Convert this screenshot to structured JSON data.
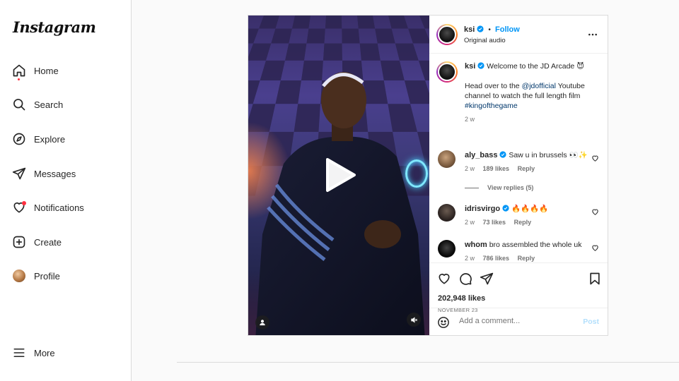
{
  "app": {
    "logo": "Instagram"
  },
  "sidebar": {
    "items": [
      {
        "label": "Home",
        "icon": "home-icon"
      },
      {
        "label": "Search",
        "icon": "search-icon"
      },
      {
        "label": "Explore",
        "icon": "compass-icon"
      },
      {
        "label": "Messages",
        "icon": "paper-plane-icon"
      },
      {
        "label": "Notifications",
        "icon": "heart-icon"
      },
      {
        "label": "Create",
        "icon": "plus-square-icon"
      },
      {
        "label": "Profile",
        "icon": "avatar"
      }
    ],
    "more_label": "More"
  },
  "post": {
    "author": "ksi",
    "follow_label": "Follow",
    "separator": "•",
    "audio": "Original audio",
    "caption": {
      "username": "ksi",
      "text": "Welcome to the JD Arcade 😈",
      "body_prefix": "Head over to the",
      "mention": "@jdofficial",
      "body_suffix": "Youtube channel to watch the full length film",
      "hashtag": "#kingofthegame",
      "time": "2 w"
    },
    "comments": [
      {
        "username": "aly_bass",
        "verified": true,
        "text": "Saw u in brussels 👀✨",
        "time": "2 w",
        "likes": "189 likes",
        "reply": "Reply",
        "view_replies": "View replies (5)"
      },
      {
        "username": "idrisvirgo",
        "verified": true,
        "text": "🔥🔥🔥🔥",
        "time": "2 w",
        "likes": "73 likes",
        "reply": "Reply"
      },
      {
        "username": "whom",
        "verified": false,
        "text": "bro assembled the whole uk",
        "time": "2 w",
        "likes": "786 likes",
        "reply": "Reply"
      }
    ],
    "likes": "202,948 likes",
    "date": "NOVEMBER 23",
    "comment_placeholder": "Add a comment...",
    "post_label": "Post"
  },
  "colors": {
    "accent": "#0095f6",
    "verified": "#0095f6",
    "notification_dot": "#ff3040"
  }
}
